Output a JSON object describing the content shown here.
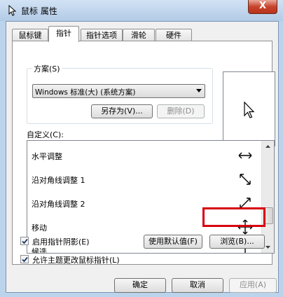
{
  "window": {
    "title": "鼠标 属性",
    "close_label": "X"
  },
  "tabs": [
    "鼠标键",
    "指针",
    "指针选项",
    "滑轮",
    "硬件"
  ],
  "active_tab": 1,
  "scheme": {
    "label": "方案(S)",
    "selected": "Windows 标准(大) (系统方案)",
    "save_as": "另存为(V)...",
    "delete": "删除(D)"
  },
  "customize": {
    "label": "自定义(C):",
    "items": [
      {
        "label": "水平调整",
        "icon": "horizontal-resize-icon"
      },
      {
        "label": "沿对角线调整 1",
        "icon": "diagonal-resize-1-icon"
      },
      {
        "label": "沿对角线调整 2",
        "icon": "diagonal-resize-2-icon"
      },
      {
        "label": "移动",
        "icon": "move-icon"
      },
      {
        "label": "候选",
        "icon": "alternate-select-icon"
      }
    ]
  },
  "enable_shadow": {
    "label": "启用指针阴影(E)",
    "checked": true
  },
  "use_default": "使用默认值(F)",
  "browse": "浏览(B)...",
  "allow_themes": {
    "label": "允许主题更改鼠标指针(L)",
    "checked": true
  },
  "footer": {
    "ok": "确定",
    "cancel": "取消",
    "apply": "应用(A)"
  }
}
